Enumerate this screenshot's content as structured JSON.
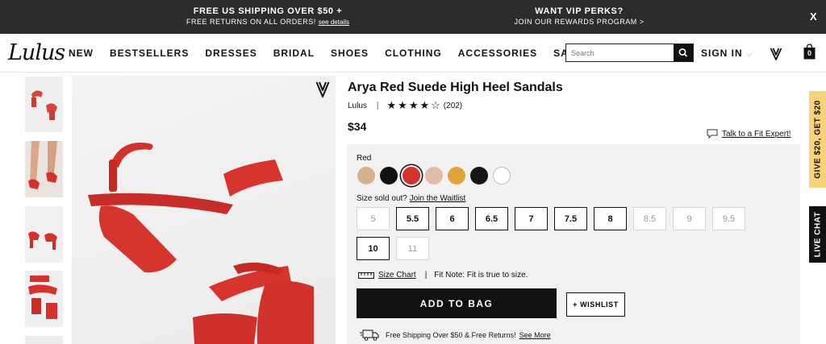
{
  "promo": {
    "left_line1": "FREE US SHIPPING OVER $50 +",
    "left_line2": "FREE RETURNS ON ALL ORDERS!",
    "left_link": "see details",
    "right_line1": "WANT VIP PERKS?",
    "right_line2": "JOIN OUR REWARDS PROGRAM >",
    "close": "X"
  },
  "nav": {
    "logo": "Lulus",
    "items": [
      "NEW",
      "BESTSELLERS",
      "DRESSES",
      "BRIDAL",
      "SHOES",
      "CLOTHING",
      "ACCESSORIES",
      "SALE"
    ],
    "search_placeholder": "Search",
    "sign_in": "SIGN IN",
    "sign_in_chevron": "⌵",
    "bag_count": "0"
  },
  "product": {
    "title": "Arya Red Suede High Heel Sandals",
    "brand": "Lulus",
    "separator": "|",
    "stars": "★★★★☆",
    "rating": 4.5,
    "reviews": "(202)",
    "price": "$34",
    "fit_expert": "Talk to a Fit Expert!",
    "color_label": "Red",
    "swatches": [
      "#d9b08c",
      "#111111",
      "#d6322c",
      "#e0bda4",
      "#e0a43a",
      "#161616",
      "#ffffff"
    ],
    "size_note": "Size sold out?",
    "waitlist": "Join the Waitlist",
    "sizes": [
      {
        "label": "5",
        "available": false
      },
      {
        "label": "5.5",
        "available": true
      },
      {
        "label": "6",
        "available": true
      },
      {
        "label": "6.5",
        "available": true
      },
      {
        "label": "7",
        "available": true
      },
      {
        "label": "7.5",
        "available": true
      },
      {
        "label": "8",
        "available": true
      },
      {
        "label": "8.5",
        "available": false
      },
      {
        "label": "9",
        "available": false
      },
      {
        "label": "9.5",
        "available": false
      },
      {
        "label": "10",
        "available": true
      },
      {
        "label": "11",
        "available": false
      }
    ],
    "size_chart": "Size Chart",
    "fit_note_sep": "|",
    "fit_note": "Fit Note: Fit is true to size.",
    "add_to_bag": "ADD TO BAG",
    "wishlist": "+ WISHLIST",
    "shipping_text": "Free Shipping Over $50 & Free Returns!",
    "see_more": "See More"
  },
  "side_tabs": {
    "give": "GIVE $20, GET $20",
    "chat": "LIVE CHAT"
  },
  "colors": {
    "promo_bg": "#2c2c2c",
    "accent_red": "#d6322c",
    "give_tab": "#f6d27a"
  }
}
